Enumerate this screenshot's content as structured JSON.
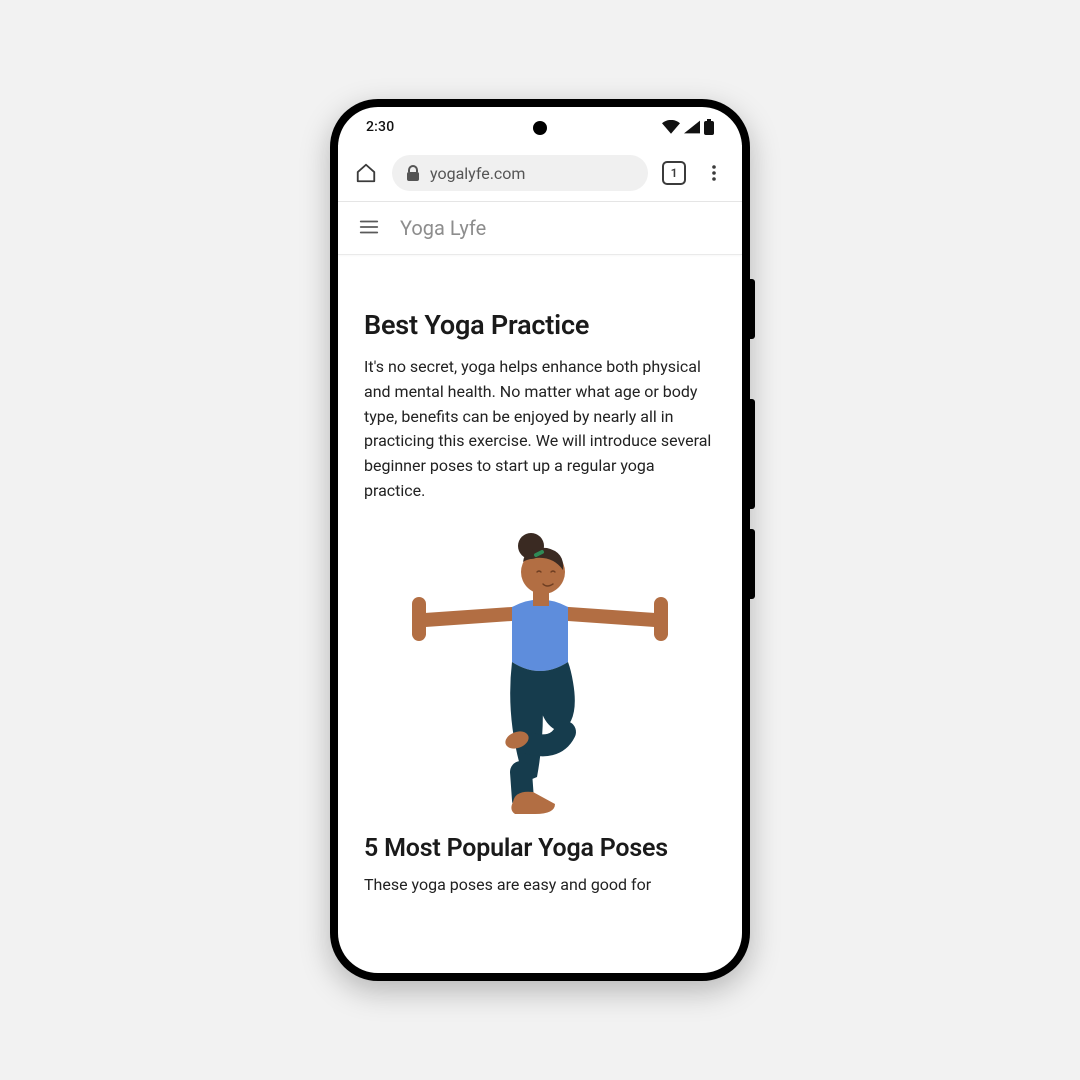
{
  "status": {
    "time": "2:30"
  },
  "browser": {
    "url": "yogalyfe.com",
    "tab_count": "1"
  },
  "site": {
    "title": "Yoga Lyfe"
  },
  "article": {
    "heading": "Best Yoga Practice",
    "intro": "It's no secret, yoga helps enhance both physical and mental health. No matter what age or body type, benefits can be enjoyed by nearly all in practicing this exercise. We will introduce several beginner poses  to start up a regular yoga practice.",
    "subheading": "5 Most Popular Yoga Poses",
    "subtext": "These yoga poses are easy and good for"
  }
}
